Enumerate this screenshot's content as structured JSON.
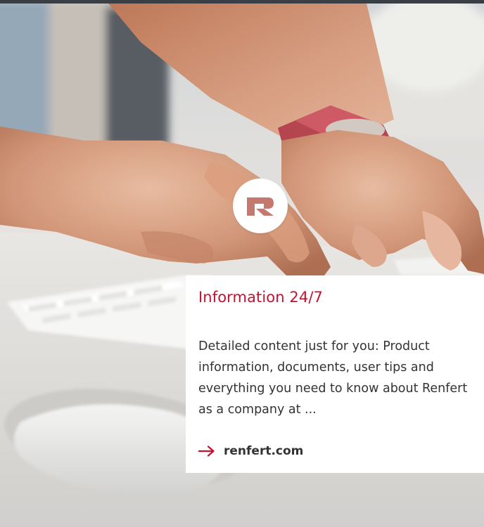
{
  "hero": {
    "image": "hands typing on a white keyboard next to a mouse",
    "logo_icon": "renfert-r-logo"
  },
  "card": {
    "title": "Information 24/7",
    "body": "Detailed content just for you: Product information, documents, user tips and everything you need to know about Renfert as a company at ...",
    "link_icon": "arrow-right-icon",
    "link_label": "renfert.com"
  },
  "colors": {
    "accent": "#c8102e",
    "text": "#333333",
    "card_bg": "#ffffff"
  }
}
